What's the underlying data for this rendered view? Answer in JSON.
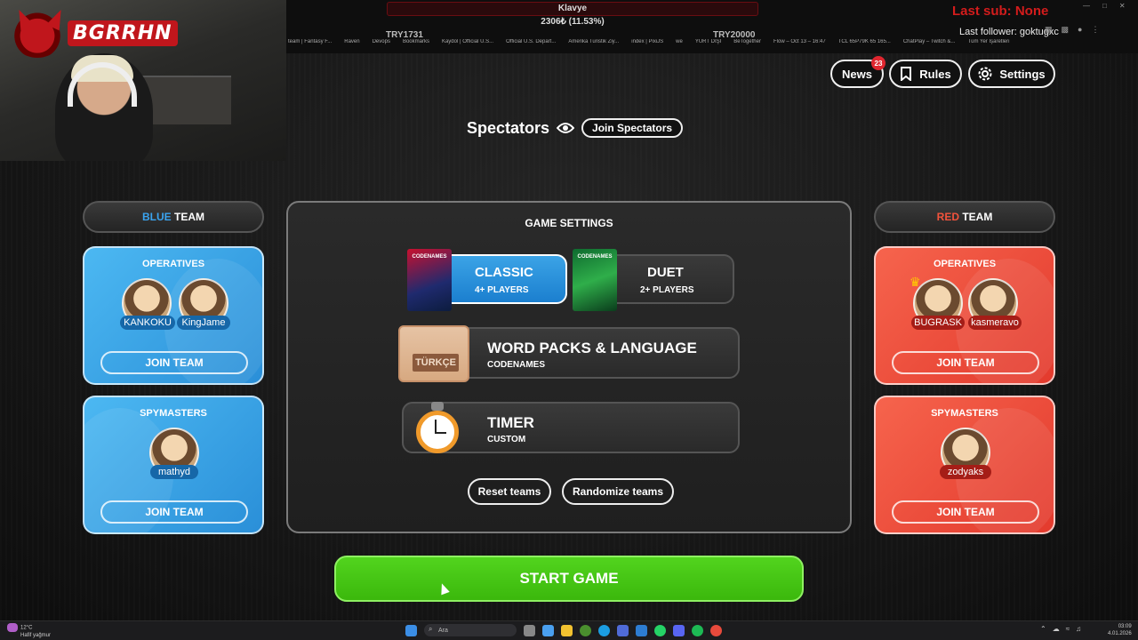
{
  "stream": {
    "logo_text": "BGRRHN",
    "goal_title": "Klavye",
    "goal_amount": "2306₺ (11.53%)",
    "goal_left": "TRY1731",
    "goal_right": "TRY20000",
    "last_sub": "Last sub: None",
    "last_follower": "Last follower: goktugxc",
    "bookmarks": [
      "team | Fantasy F...",
      "Raven",
      "Devops",
      "Bookmarks",
      "Kaydol | Official U.S...",
      "Official U.S. Depart...",
      "Amerika Turistik Ziy...",
      "index | PixiJS",
      "we",
      "YURT DIŞI",
      "BeTogether",
      "Flow – Oct 13 – 16:47",
      "TCL 65P79K 65 165...",
      "ChatPlay – Twitch &...",
      "Tüm Yer İşaretleri"
    ]
  },
  "nav": {
    "news_label": "News",
    "news_badge": "23",
    "rules_label": "Rules",
    "settings_label": "Settings"
  },
  "spectators": {
    "label": "Spectators",
    "join_label": "Join Spectators"
  },
  "blue_team": {
    "color_word": "BLUE",
    "team_word": "TEAM",
    "operatives_title": "OPERATIVES",
    "operatives": [
      "KANKOKU",
      "KingJame"
    ],
    "spymasters_title": "SPYMASTERS",
    "spymasters": [
      "mathyd"
    ],
    "join_label": "JOIN TEAM"
  },
  "red_team": {
    "color_word": "RED",
    "team_word": "TEAM",
    "operatives_title": "OPERATIVES",
    "operatives": [
      "BUGRASK",
      "kasmeravo"
    ],
    "spymasters_title": "SPYMASTERS",
    "spymasters": [
      "zodyaks"
    ],
    "join_label": "JOIN TEAM"
  },
  "game_settings": {
    "title": "GAME SETTINGS",
    "modes": [
      {
        "name": "CLASSIC",
        "players": "4+ PLAYERS",
        "box": "CODENAMES",
        "active": true
      },
      {
        "name": "DUET",
        "players": "2+ PLAYERS",
        "box": "CODENAMES",
        "active": false
      }
    ],
    "word_packs": {
      "title": "WORD PACKS & LANGUAGE",
      "subtitle": "CODENAMES",
      "language": "TÜRKÇE"
    },
    "timer": {
      "title": "TIMER",
      "subtitle": "CUSTOM"
    },
    "reset_label": "Reset teams",
    "randomize_label": "Randomize teams"
  },
  "start_label": "START GAME",
  "taskbar": {
    "temp": "12°C",
    "weather": "Hafif yağmur",
    "search_placeholder": "Ara",
    "time": "03:09",
    "date": "4.01.2026"
  },
  "colors": {
    "blue": "#3aa4f0",
    "red": "#f2533c",
    "green": "#46c616",
    "accent_red": "#d31c1c"
  }
}
